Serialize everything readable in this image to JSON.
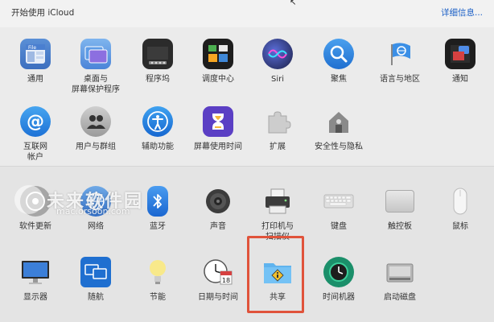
{
  "header": {
    "left_text": "开始使用 iCloud",
    "right_link": "详细信息..."
  },
  "row1": [
    {
      "label": "通用",
      "icon": "general-icon"
    },
    {
      "label": "桌面与\n屏幕保护程序",
      "icon": "desktop-screensaver-icon"
    },
    {
      "label": "程序坞",
      "icon": "dock-icon"
    },
    {
      "label": "调度中心",
      "icon": "mission-control-icon"
    },
    {
      "label": "Siri",
      "icon": "siri-icon"
    },
    {
      "label": "聚焦",
      "icon": "spotlight-icon"
    },
    {
      "label": "语言与地区",
      "icon": "language-region-icon"
    },
    {
      "label": "通知",
      "icon": "notifications-icon"
    }
  ],
  "row2": [
    {
      "label": "互联网\n帐户",
      "icon": "internet-accounts-icon"
    },
    {
      "label": "用户与群组",
      "icon": "users-groups-icon"
    },
    {
      "label": "辅助功能",
      "icon": "accessibility-icon"
    },
    {
      "label": "屏幕使用时间",
      "icon": "screen-time-icon"
    },
    {
      "label": "扩展",
      "icon": "extensions-icon"
    },
    {
      "label": "安全性与隐私",
      "icon": "security-privacy-icon"
    }
  ],
  "row3": [
    {
      "label": "软件更新",
      "icon": "software-update-icon"
    },
    {
      "label": "网络",
      "icon": "network-icon"
    },
    {
      "label": "蓝牙",
      "icon": "bluetooth-icon"
    },
    {
      "label": "声音",
      "icon": "sound-icon"
    },
    {
      "label": "打印机与\n扫描仪",
      "icon": "printers-scanners-icon"
    },
    {
      "label": "键盘",
      "icon": "keyboard-icon"
    },
    {
      "label": "触控板",
      "icon": "trackpad-icon"
    },
    {
      "label": "鼠标",
      "icon": "mouse-icon"
    }
  ],
  "row4": [
    {
      "label": "显示器",
      "icon": "displays-icon"
    },
    {
      "label": "随航",
      "icon": "sidecar-icon"
    },
    {
      "label": "节能",
      "icon": "energy-saver-icon"
    },
    {
      "label": "日期与时间",
      "icon": "date-time-icon"
    },
    {
      "label": "共享",
      "icon": "sharing-icon"
    },
    {
      "label": "时间机器",
      "icon": "time-machine-icon"
    },
    {
      "label": "启动磁盘",
      "icon": "startup-disk-icon"
    }
  ],
  "watermark": {
    "title": "未来软件园",
    "url": "mac.orsoon.com"
  },
  "calendar_day": "18",
  "colors": {
    "link": "#1a5fc6",
    "highlight": "#e0533b"
  }
}
